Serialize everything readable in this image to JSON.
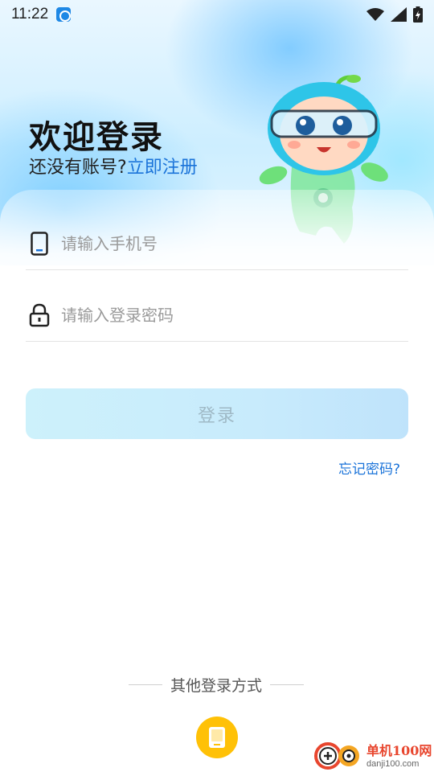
{
  "status_bar": {
    "time": "11:22",
    "icons": [
      "app-notification-icon",
      "wifi-icon",
      "signal-icon",
      "battery-charging-icon"
    ]
  },
  "header": {
    "title": "欢迎登录",
    "register_prompt": "还没有账号?",
    "register_link": "立即注册"
  },
  "form": {
    "phone": {
      "placeholder": "请输入手机号",
      "value": "",
      "icon": "phone-icon"
    },
    "password": {
      "placeholder": "请输入登录密码",
      "value": "",
      "icon": "lock-icon"
    },
    "login_label": "登录",
    "forgot_label": "忘记密码?"
  },
  "other_login": {
    "label": "其他登录方式",
    "phone_button_icon": "phone-icon"
  },
  "watermark": {
    "name": "单机100网",
    "url": "danji100.com"
  },
  "colors": {
    "accent_link": "#1a73d9",
    "login_button_bg": "#c8ebfc",
    "other_login_button": "#ffc107"
  }
}
